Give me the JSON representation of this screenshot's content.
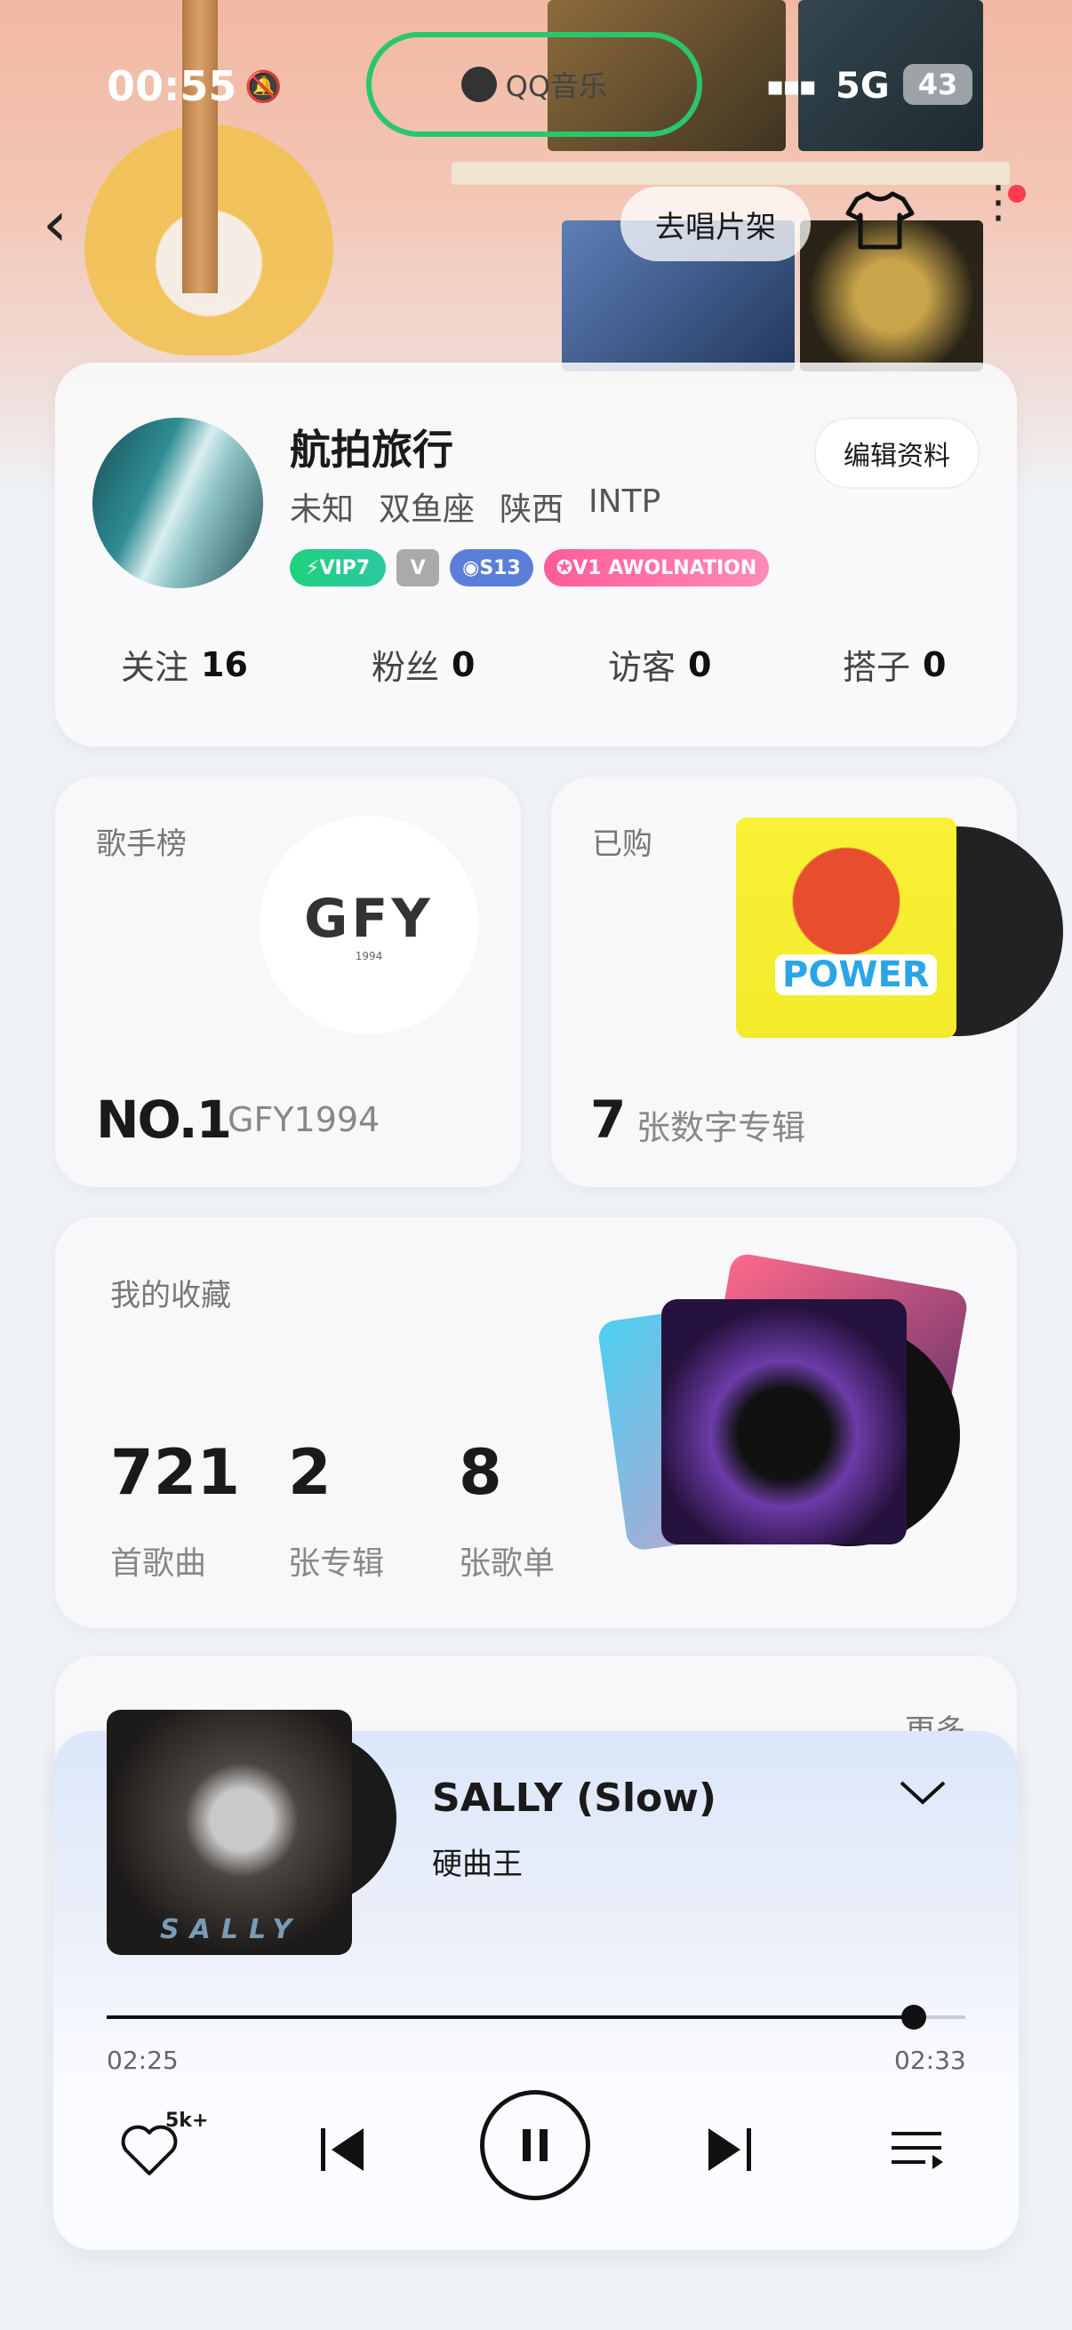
{
  "status_bar": {
    "time": "00:55",
    "network": "5G",
    "battery": "43"
  },
  "island": {
    "app_name": "QQ音乐"
  },
  "nav": {
    "shelf_button": "去唱片架"
  },
  "profile": {
    "nickname": "航拍旅行",
    "edit_button": "编辑资料",
    "tags": [
      "未知",
      "双鱼座",
      "陕西",
      "INTP"
    ],
    "badges": {
      "vip": "VIP7",
      "level": "S13",
      "artist": "V1 AWOLNATION"
    },
    "stats": [
      {
        "label": "关注",
        "value": "16"
      },
      {
        "label": "粉丝",
        "value": "0"
      },
      {
        "label": "访客",
        "value": "0"
      },
      {
        "label": "搭子",
        "value": "0"
      }
    ]
  },
  "singer_rank": {
    "title": "歌手榜",
    "rank": "NO.1",
    "name": "GFY1994",
    "logo_text": "GFY",
    "logo_sub": "1994"
  },
  "bought": {
    "title": "已购",
    "count": "7",
    "label": "张数字专辑",
    "cover_text": "POWER"
  },
  "collection": {
    "title": "我的收藏",
    "items": [
      {
        "value": "721",
        "label": "首歌曲"
      },
      {
        "value": "2",
        "label": "张专辑"
      },
      {
        "value": "8",
        "label": "张歌单"
      }
    ]
  },
  "next_section": {
    "more_link": "更多"
  },
  "player": {
    "title": "SALLY (Slow)",
    "artist": "硬曲王",
    "cover_text": "SALLY",
    "time_current": "02:25",
    "time_total": "02:33",
    "progress": 0.94,
    "like_count": "5k+"
  }
}
